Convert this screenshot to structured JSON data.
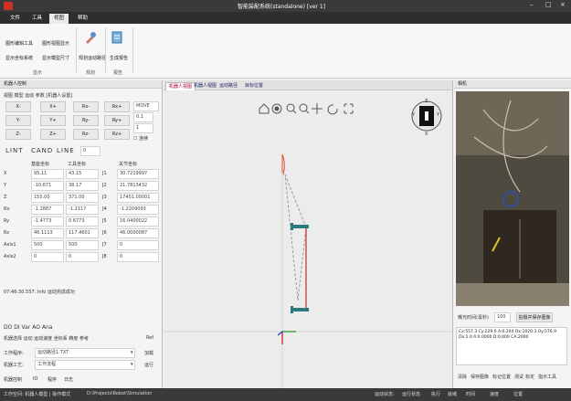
{
  "app": {
    "window_title": "智能装配系统(standalone) [ver 1]",
    "window_controls": [
      "–",
      "□",
      "×"
    ]
  },
  "menu": [
    "文件",
    "工具",
    "视图",
    "帮助"
  ],
  "ribbon": {
    "buttons_row1": [
      "图形编辑工具",
      "图形视图显示"
    ],
    "buttons_row2": [
      "显示坐标系统",
      "显示模型尺寸"
    ],
    "big_buttons": [
      "规划运动路径",
      "生成报告"
    ],
    "groups": [
      "显示",
      "规划",
      "报告"
    ]
  },
  "left_panel": {
    "header": "机器人控制",
    "subtabs": "视图  模型  运动  参数  [机器人设置]",
    "jog_buttons": [
      [
        "X-",
        "X+",
        "Rx-",
        "Rx+"
      ],
      [
        "Y-",
        "Y+",
        "Ry-",
        "Ry+"
      ],
      [
        "Z-",
        "Z+",
        "Rz-",
        "Rz+"
      ]
    ],
    "speed_select": "MOVE",
    "speed_value": "0.1",
    "step_value": "1",
    "checkbox_label": "连续",
    "mode_labels": [
      "LINT",
      "CAND",
      "LINE"
    ],
    "mode_value": "0",
    "table_headers": [
      "基座坐标",
      "工具坐标",
      "关节坐标"
    ],
    "table_rows": [
      [
        "X",
        "95.11",
        "43.15",
        "J1",
        "30.7219997"
      ],
      [
        "Y",
        "-10.671",
        "38.17",
        "J2",
        "21.7813432"
      ],
      [
        "Z",
        "155.00",
        "371.00",
        "J3",
        "17401.00001"
      ],
      [
        "Rx",
        "-1.2887",
        "-1.2117",
        "J4",
        "-1.2209093"
      ],
      [
        "Ry",
        "-1.4773",
        "0.6773",
        "J5",
        "16.0400022"
      ],
      [
        "Rz",
        "46.1113",
        "117.4601",
        "J6",
        "46.0000087"
      ],
      [
        "Axis1",
        "500",
        "500",
        "J7",
        "0"
      ],
      [
        "Axis2",
        "0",
        "0",
        "J8",
        "0"
      ]
    ],
    "status_line": "07:46:30.557: Info 运动完成成功",
    "io_line": "DO  DI  Var  AO  Ana",
    "options_row": "机器选择  运动  运动速度  坐标系  精度  参考",
    "options_right": "Ref",
    "field1_label": "工作程序:",
    "field1_value": "运动路径1.TXT",
    "field1_btn": "加载",
    "field2_label": "机器工艺:",
    "field2_value": "工作流程",
    "field2_btn": "运行",
    "bottom_tabs": [
      "机器控制",
      "IO",
      "程序",
      "日志"
    ]
  },
  "viewport": {
    "tabs": [
      "机器人视图",
      "机器人视图",
      "运动路径",
      "目标位置"
    ],
    "toolbar_icons": [
      "home-icon",
      "target-icon",
      "zoom-in-icon",
      "zoom-out-icon",
      "pan-icon",
      "rotate-icon",
      "fit-icon"
    ],
    "gizmo_labels": [
      "Z",
      "Y",
      "X",
      "Y"
    ]
  },
  "camera_panel": {
    "header": "相机",
    "exposure_label": "曝光时间(毫秒)",
    "exposure_value": "100",
    "capture_button": "拍摄并保存图像",
    "log_text": "Cx:557.3 Cy:229.0 A:0.204 Ox:1020.3 Oy:576.9 Dx:1.0 A:0.0000 D:0.000 CA:2000",
    "footer": [
      "清除",
      "保存图像",
      "标记位置",
      "测试",
      "标定",
      "指示工具"
    ]
  },
  "statusbar": {
    "left": "工作空间: 机器人模型 | 操作模式",
    "path": "D:\\Projects\\Robot\\Simulation",
    "right": [
      "运动状态:",
      "运行状态",
      "执行",
      "就绪",
      "时间",
      "速度",
      "位置"
    ]
  }
}
